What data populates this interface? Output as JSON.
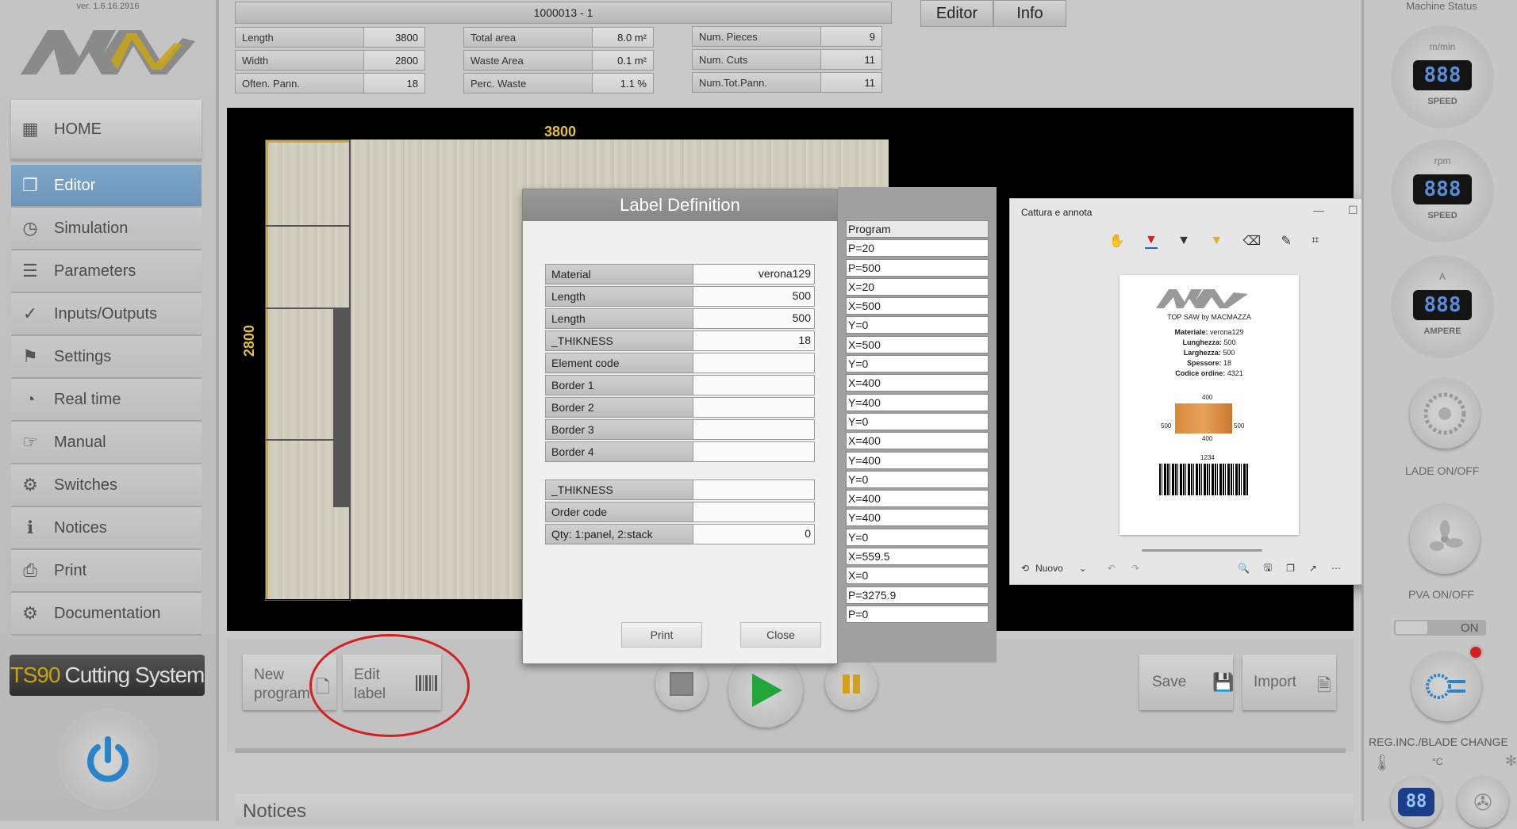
{
  "app": {
    "version": "ver. 1.6.16.2916"
  },
  "sidebar": {
    "items": [
      {
        "label": "HOME",
        "icon": "calculator-icon"
      },
      {
        "label": "Editor",
        "icon": "copy-icon"
      },
      {
        "label": "Simulation",
        "icon": "clock-icon"
      },
      {
        "label": "Parameters",
        "icon": "list-icon"
      },
      {
        "label": "Inputs/Outputs",
        "icon": "check-circle-icon"
      },
      {
        "label": "Settings",
        "icon": "flag-icon"
      },
      {
        "label": "Real time",
        "icon": "dashboard-icon"
      },
      {
        "label": "Manual",
        "icon": "hand-pointer-icon"
      },
      {
        "label": "Switches",
        "icon": "gears-icon"
      },
      {
        "label": "Notices",
        "icon": "info-icon"
      },
      {
        "label": "Print",
        "icon": "printer-icon"
      },
      {
        "label": "Documentation",
        "icon": "gears-icon"
      }
    ],
    "active": "Editor",
    "brand_prefix": "TS90",
    "brand_suffix": "Cutting System"
  },
  "header": {
    "program_title": "1000013 - 1",
    "tabs": [
      "Editor",
      "Info"
    ],
    "info_col1": [
      {
        "label": "Length",
        "value": "3800"
      },
      {
        "label": "Width",
        "value": "2800"
      },
      {
        "label": "Often. Pann.",
        "value": "18"
      }
    ],
    "info_col2": [
      {
        "label": "Total area",
        "value": "8.0 m²"
      },
      {
        "label": "Waste Area",
        "value": "0.1 m²"
      },
      {
        "label": "Perc. Waste",
        "value": "1.1 %"
      }
    ],
    "info_col3": [
      {
        "label": "Num. Pieces",
        "value": "9"
      },
      {
        "label": "Num. Cuts",
        "value": "11"
      },
      {
        "label": "Num.Tot.Pann.",
        "value": "11"
      }
    ]
  },
  "canvas": {
    "width_label": "3800",
    "height_label": "2800"
  },
  "label_dialog": {
    "title": "Label Definition",
    "rows": [
      {
        "label": "Material",
        "value": "verona129"
      },
      {
        "label": "Length",
        "value": "500"
      },
      {
        "label": "Length",
        "value": "500"
      },
      {
        "label": "_THIKNESS",
        "value": "18"
      },
      {
        "label": "Element code",
        "value": ""
      },
      {
        "label": "Border 1",
        "value": ""
      },
      {
        "label": "Border 2",
        "value": ""
      },
      {
        "label": "Border 3",
        "value": ""
      },
      {
        "label": "Border 4",
        "value": ""
      }
    ],
    "rows2": [
      {
        "label": "_THIKNESS",
        "value": ""
      },
      {
        "label": "Order code",
        "value": ""
      },
      {
        "label": "Qty: 1:panel, 2:stack",
        "value": "0"
      }
    ],
    "print_label": "Print",
    "close_label": "Close"
  },
  "program_list": {
    "header": "Program",
    "lines": [
      "P=20",
      "P=500",
      "X=20",
      "X=500",
      "Y=0",
      "X=500",
      "Y=0",
      "X=400",
      "Y=400",
      "Y=0",
      "X=400",
      "Y=400",
      "Y=0",
      "X=400",
      "Y=400",
      "Y=0",
      "X=559.5",
      "X=0",
      "P=3275.9",
      "P=0"
    ]
  },
  "snip_window": {
    "title": "Cattura e annota",
    "new_label": "Nuovo",
    "doc": {
      "logo_sub": "TOP SAW by MACMAZZA",
      "lines": [
        {
          "k": "Materiale:",
          "v": "verona129"
        },
        {
          "k": "Lunghezza:",
          "v": "500"
        },
        {
          "k": "Larghezza:",
          "v": "500"
        },
        {
          "k": "Spessore:",
          "v": "18"
        },
        {
          "k": "Codice ordine:",
          "v": "4321"
        }
      ],
      "top_dim": "400",
      "left_dim": "500",
      "right_dim": "500",
      "bottom_dim": "400",
      "barcode_num": "1234"
    }
  },
  "toolbar": {
    "new_program": "New program",
    "edit_label": "Edit label",
    "save": "Save",
    "import": "Import",
    "notices": "Notices"
  },
  "machine": {
    "title": "Machine Status",
    "speed_unit": "m/min",
    "speed_label": "SPEED",
    "rpm_unit": "rpm",
    "rpm_label": "SPEED",
    "amp_unit": "A",
    "amp_label": "AMPERE",
    "lcd": "888",
    "blade": "LADE ON/OFF",
    "pva": "PVA ON/OFF",
    "on": "ON",
    "reg": "REG.INC./BLADE CHANGE",
    "temp_unit": "°C",
    "temp_lcd": "88"
  },
  "colors": {
    "accent": "#6e96ba",
    "highlight_circle": "#d42020",
    "play": "#22a53a",
    "pause": "#d4a017"
  }
}
